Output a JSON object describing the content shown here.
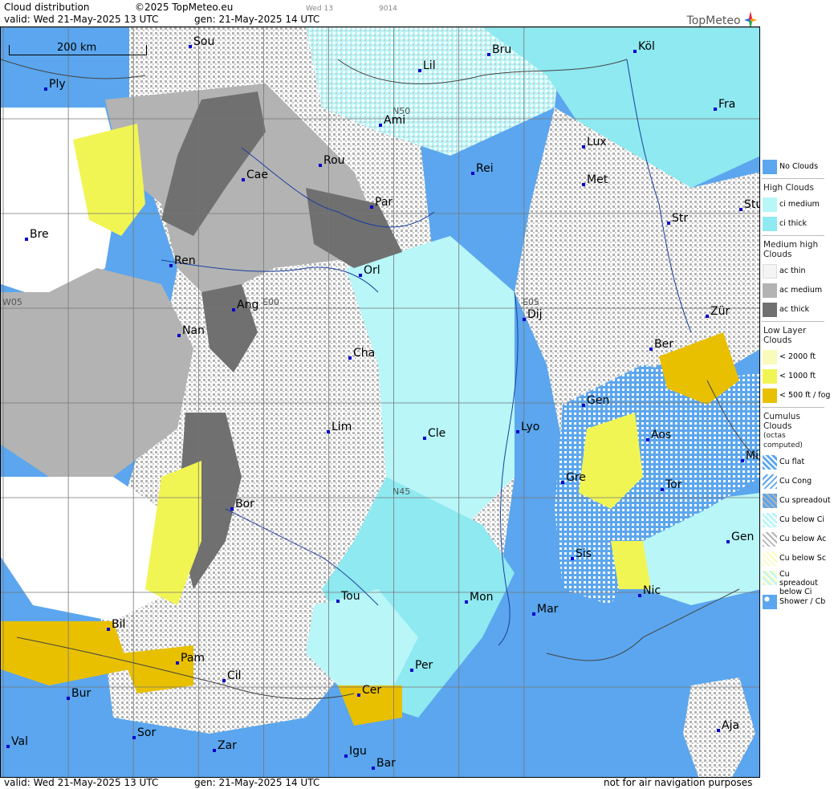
{
  "header": {
    "title": "Cloud distribution",
    "copyright": "©2025 TopMeteo.eu",
    "tiny1": "Wed 13",
    "tiny2": "9014",
    "valid": "valid:  Wed  21-May-2025  13 UTC",
    "gen": "gen: 21-May-2025 14 UTC",
    "logo": "TopMeteo"
  },
  "footer": {
    "valid": "valid:  Wed  21-May-2025  13 UTC",
    "gen": "gen: 21-May-2025 14 UTC",
    "disclaimer": "not for air navigation purposes"
  },
  "map": {
    "scale": "200 km",
    "grid_labels": [
      "N50",
      "N45",
      "W05",
      "E00",
      "E05"
    ],
    "cities": [
      "Sou",
      "Bru",
      "Köl",
      "Ply",
      "Lil",
      "Fra",
      "Ami",
      "Lux",
      "Rou",
      "Rei",
      "Cae",
      "Met",
      "Par",
      "Stu",
      "Bre",
      "Str",
      "Ren",
      "Orl",
      "Ang",
      "Zür",
      "Nan",
      "Dij",
      "Ber",
      "Cha",
      "Gen",
      "Lim",
      "Cle",
      "Lyo",
      "Aos",
      "Mil",
      "Gre",
      "Tor",
      "Bor",
      "Gen",
      "Sis",
      "Tou",
      "Mon",
      "Nic",
      "Mar",
      "Bil",
      "Pam",
      "Per",
      "Cil",
      "Cer",
      "Bur",
      "Sor",
      "Aja",
      "Val",
      "Zar",
      "Igu",
      "Bar"
    ]
  },
  "legend": {
    "no_clouds": "No Clouds",
    "high_head": "High Clouds",
    "ci_medium": "ci medium",
    "ci_thick": "ci thick",
    "medium_head": "Medium high Clouds",
    "ac_thin": "ac thin",
    "ac_medium": "ac medium",
    "ac_thick": "ac thick",
    "low_head": "Low Layer Clouds",
    "low1": "< 2000 ft",
    "low2": "< 1000 ft",
    "low3": "< 500 ft / fog",
    "cu_head": "Cumulus Clouds",
    "cu_sub": "(octas computed)",
    "cu_flat": "Cu flat",
    "cu_cong": "Cu Cong",
    "cu_spread": "Cu spreadout",
    "cu_below_ci": "Cu below Ci",
    "cu_below_ac": "Cu below Ac",
    "cu_below_sc": "Cu below Sc",
    "cu_spread_ci": "Cu spreadout below Ci",
    "shower": "Shower / Cb"
  },
  "colors": {
    "no_clouds": "#5ba6ee",
    "ci_medium": "#b8f6f8",
    "ci_thick": "#8ee9f0",
    "ac_thin": "#f4f4f4",
    "ac_medium": "#b3b3b3",
    "ac_thick": "#707070",
    "low1": "#f8fbbb",
    "low2": "#f1f554",
    "low3": "#e8c000"
  }
}
